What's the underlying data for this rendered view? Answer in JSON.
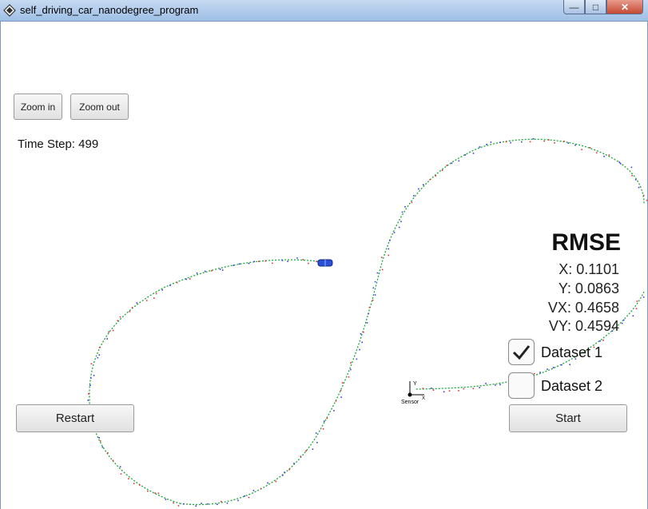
{
  "window": {
    "title": "self_driving_car_nanodegree_program",
    "min_label": "—",
    "max_label": "□",
    "close_label": "✕"
  },
  "controls": {
    "zoom_in": "Zoom in",
    "zoom_out": "Zoom out",
    "restart": "Restart",
    "start": "Start"
  },
  "status": {
    "time_step": "Time Step: 499"
  },
  "rmse": {
    "title": "RMSE",
    "x": "X: 0.1101",
    "y": "Y: 0.0863",
    "vx": "VX: 0.4658",
    "vy": "VY: 0.4594"
  },
  "datasets": [
    {
      "label": "Dataset 1",
      "checked": true
    },
    {
      "label": "Dataset 2",
      "checked": false
    }
  ],
  "sensor": {
    "label": "Sensor",
    "axis_y": "Y",
    "axis_x": "X"
  },
  "colors": {
    "ground_truth": "#1aa63a",
    "radar": "#3a3ae0",
    "lidar": "#e03030",
    "car": "#2a4fd8"
  }
}
